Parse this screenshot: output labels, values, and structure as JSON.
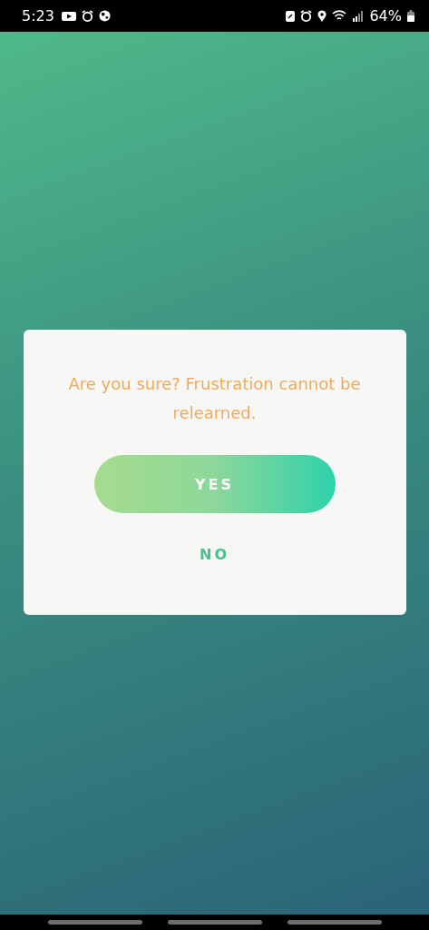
{
  "status_bar": {
    "time": "5:23",
    "battery": "64%"
  },
  "dialog": {
    "message": "Are you sure? Frustration cannot be relearned.",
    "buttons": [
      {
        "label": "YES",
        "kind": "primary"
      },
      {
        "label": "NO",
        "kind": "text"
      }
    ]
  }
}
